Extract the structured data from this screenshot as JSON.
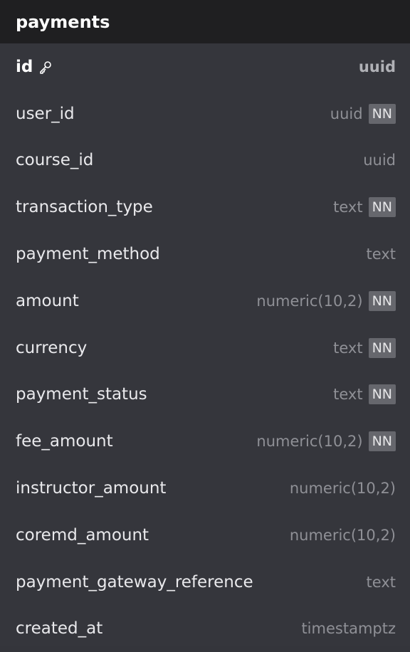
{
  "table": {
    "name": "payments",
    "columns": [
      {
        "name": "id",
        "type": "uuid",
        "primary_key": true,
        "not_null": false,
        "icon": "key-icon"
      },
      {
        "name": "user_id",
        "type": "uuid",
        "not_null": true
      },
      {
        "name": "course_id",
        "type": "uuid",
        "not_null": false
      },
      {
        "name": "transaction_type",
        "type": "text",
        "not_null": true
      },
      {
        "name": "payment_method",
        "type": "text",
        "not_null": false
      },
      {
        "name": "amount",
        "type": "numeric(10,2)",
        "not_null": true
      },
      {
        "name": "currency",
        "type": "text",
        "not_null": true
      },
      {
        "name": "payment_status",
        "type": "text",
        "not_null": true
      },
      {
        "name": "fee_amount",
        "type": "numeric(10,2)",
        "not_null": true
      },
      {
        "name": "instructor_amount",
        "type": "numeric(10,2)",
        "not_null": false
      },
      {
        "name": "coremd_amount",
        "type": "numeric(10,2)",
        "not_null": false
      },
      {
        "name": "payment_gateway_reference",
        "type": "text",
        "not_null": false
      },
      {
        "name": "created_at",
        "type": "timestamptz",
        "not_null": false
      }
    ],
    "nn_label": "NN"
  },
  "colors": {
    "header_bg": "#1f1f21",
    "body_bg": "#35363c",
    "badge_bg": "#66676d"
  }
}
